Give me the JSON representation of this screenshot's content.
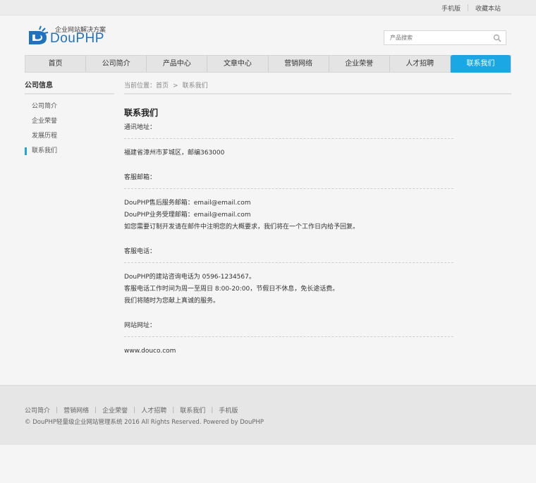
{
  "topbar": {
    "mobile": "手机版",
    "favorite": "收藏本站"
  },
  "logo": {
    "tagline": "企业网站解决方案",
    "brand": "DouPHP",
    "color": "#1f72bf"
  },
  "search": {
    "placeholder": "产品搜索"
  },
  "nav": {
    "items": [
      "首页",
      "公司简介",
      "产品中心",
      "文章中心",
      "营销网络",
      "企业荣誉",
      "人才招聘",
      "联系我们"
    ],
    "active_color": "#1aa7e4"
  },
  "sidebar": {
    "title": "公司信息",
    "items": [
      "公司简介",
      "企业荣誉",
      "发展历程",
      "联系我们"
    ]
  },
  "breadcrumb": {
    "prefix": "当前位置：",
    "home": "首页",
    "sep": ">",
    "current": "联系我们"
  },
  "page": {
    "title": "联系我们",
    "address_label": "通讯地址：",
    "address": "福建省漳州市芗城区，邮编363000",
    "email_label": "客服邮箱：",
    "email_lines": [
      "DouPHP售后服务邮箱：email@email.com",
      "DouPHP业务受理邮箱：email@email.com",
      "如您需要订制开发请在邮件中注明您的大概要求，我们将在一个工作日内给予回复。"
    ],
    "phone_label": "客服电话：",
    "phone_lines": [
      "DouPHP的建站咨询电话为 0596-1234567。",
      "客服电话工作时间为周一至周日 8:00-20:00，节假日不休息，免长途话费。",
      "我们将随时为您献上真诚的服务。"
    ],
    "website_label": "网站网址：",
    "website": "www.douco.com"
  },
  "footer": {
    "links": [
      "公司简介",
      "营销网络",
      "企业荣誉",
      "人才招聘",
      "联系我们",
      "手机版"
    ],
    "sep": "|",
    "copyright": "© DouPHP轻量级企业网站管理系统 2016 All Rights Reserved. Powered by DouPHP"
  }
}
